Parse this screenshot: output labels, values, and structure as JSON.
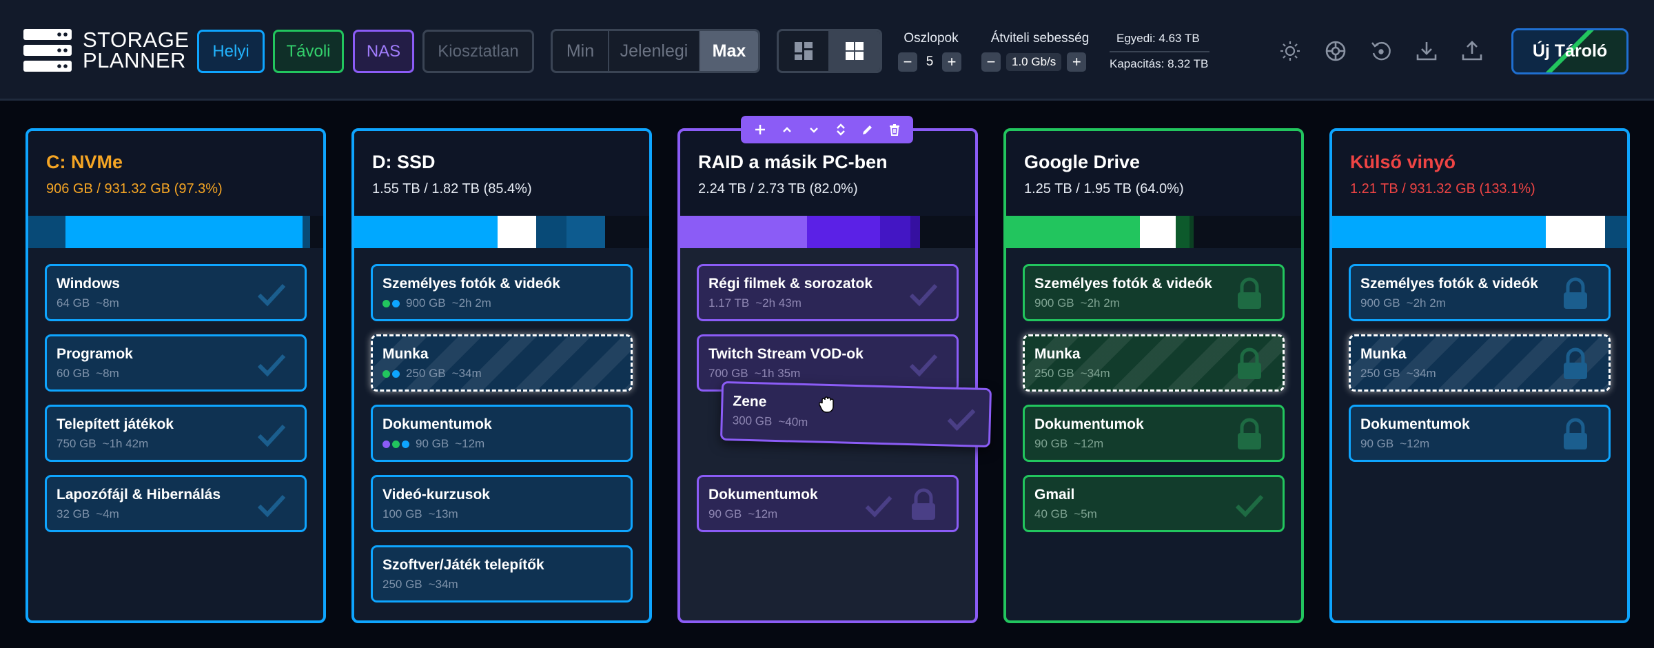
{
  "app": {
    "logo_line1": "STORAGE",
    "logo_line2": "PLANNER"
  },
  "filters": {
    "helyi": "Helyi",
    "tavoli": "Távoli",
    "nas": "NAS",
    "kiosztatlan": "Kiosztatlan"
  },
  "size_modes": {
    "min": "Min",
    "current": "Jelenlegi",
    "max": "Max",
    "selected": "Max"
  },
  "view_modes": {
    "selected": "grid-4-icon"
  },
  "columns_control": {
    "label": "Oszlopok",
    "value": "5",
    "minus": "−",
    "plus": "+"
  },
  "speed_control": {
    "label": "Átviteli sebesség",
    "value": "1.0 Gb/s",
    "minus": "−",
    "plus": "+"
  },
  "stats": {
    "unique": "Egyedi: 4.63 TB",
    "capacity": "Kapacitás: 8.32 TB"
  },
  "toolbar_icons": [
    "sun-icon",
    "steering-wheel-icon",
    "reset-icon",
    "download-icon",
    "upload-icon"
  ],
  "new_button": "Új Tároló",
  "colors": {
    "blue": "#0ea5ff",
    "green": "#22c55e",
    "purple": "#8b5cf6",
    "orange": "#f5a524",
    "red": "#ef4444"
  },
  "drives": [
    {
      "title": "C: NVMe",
      "usage": "906 GB / 931.32 GB  (97.3%)",
      "title_color": "#f5a524",
      "items": [
        {
          "name": "Windows",
          "size": "64 GB",
          "time": "~8m"
        },
        {
          "name": "Programok",
          "size": "60 GB",
          "time": "~8m"
        },
        {
          "name": "Telepített játékok",
          "size": "750 GB",
          "time": "~1h 42m"
        },
        {
          "name": "Lapozófájl & Hibernálás",
          "size": "32 GB",
          "time": "~4m"
        }
      ]
    },
    {
      "title": "D: SSD",
      "usage": "1.55 TB / 1.82 TB  (85.4%)",
      "title_color": "#ffffff",
      "items": [
        {
          "name": "Személyes fotók & videók",
          "size": "900 GB",
          "time": "~2h 2m"
        },
        {
          "name": "Munka",
          "size": "250 GB",
          "time": "~34m"
        },
        {
          "name": "Dokumentumok",
          "size": "90 GB",
          "time": "~12m"
        },
        {
          "name": "Videó-kurzusok",
          "size": "100 GB",
          "time": "~13m"
        },
        {
          "name": "Szoftver/Játék telepítők",
          "size": "250 GB",
          "time": "~34m"
        }
      ]
    },
    {
      "title": "RAID a másik PC-ben",
      "usage": "2.24 TB / 2.73 TB  (82.0%)",
      "title_color": "#ffffff",
      "items": [
        {
          "name": "Régi filmek & sorozatok",
          "size": "1.17 TB",
          "time": "~2h 43m"
        },
        {
          "name": "Twitch Stream VOD-ok",
          "size": "700 GB",
          "time": "~1h 35m"
        },
        {
          "name": "Dokumentumok",
          "size": "90 GB",
          "time": "~12m"
        }
      ],
      "dragging": {
        "name": "Zene",
        "size": "300 GB",
        "time": "~40m"
      }
    },
    {
      "title": "Google Drive",
      "usage": "1.25 TB / 1.95 TB  (64.0%)",
      "title_color": "#ffffff",
      "items": [
        {
          "name": "Személyes fotók & videók",
          "size": "900 GB",
          "time": "~2h 2m"
        },
        {
          "name": "Munka",
          "size": "250 GB",
          "time": "~34m"
        },
        {
          "name": "Dokumentumok",
          "size": "90 GB",
          "time": "~12m"
        },
        {
          "name": "Gmail",
          "size": "40 GB",
          "time": "~5m"
        }
      ]
    },
    {
      "title": "Külső vinyó",
      "usage": "1.21 TB / 931.32 GB  (133.1%)",
      "title_color": "#ef4444",
      "items": [
        {
          "name": "Személyes fotók & videók",
          "size": "900 GB",
          "time": "~2h 2m"
        },
        {
          "name": "Munka",
          "size": "250 GB",
          "time": "~34m"
        },
        {
          "name": "Dokumentumok",
          "size": "90 GB",
          "time": "~12m"
        }
      ]
    }
  ]
}
